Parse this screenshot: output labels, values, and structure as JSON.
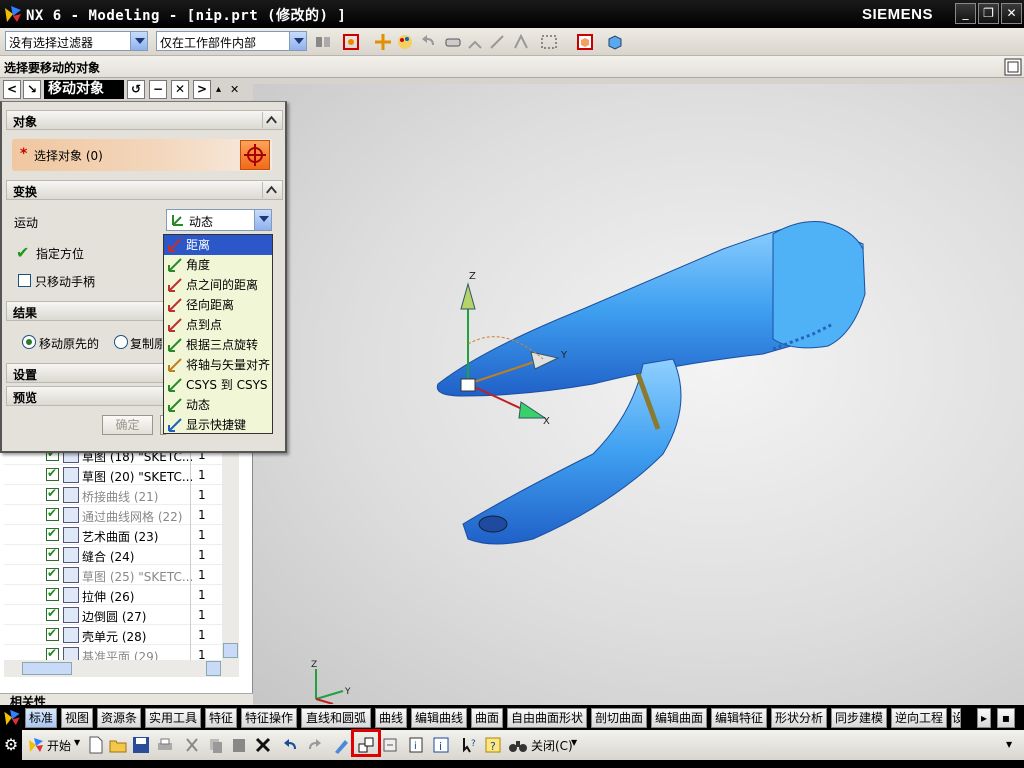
{
  "window": {
    "title": "NX 6 - Modeling - [nip.prt  (修改的) ]",
    "brand": "SIEMENS",
    "controls": [
      "_",
      "❐",
      "✕"
    ]
  },
  "toolbar": {
    "selection_filter": "没有选择过滤器",
    "selection_scope": "仅在工作部件内部"
  },
  "cue_line": "选择要移动的对象",
  "dialog": {
    "title": "移动对象",
    "object_group": "对象",
    "select_object": "选择对象 (0)",
    "transform_group": "变换",
    "motion_label": "运动",
    "motion_value": "动态",
    "specify_orientation": "指定方位",
    "move_handle_only": "只移动手柄",
    "result_group": "结果",
    "move_original": "移动原先的",
    "copy_original": "复制原先的",
    "settings_group": "设置",
    "preview_group": "预览",
    "ok_button": "确定",
    "motion_options": [
      {
        "label": "距离",
        "icon": "distance-icon",
        "selected": true
      },
      {
        "label": "角度",
        "icon": "angle-icon",
        "selected": false
      },
      {
        "label": "点之间的距离",
        "icon": "point-distance-icon",
        "selected": false
      },
      {
        "label": "径向距离",
        "icon": "radial-distance-icon",
        "selected": false
      },
      {
        "label": "点到点",
        "icon": "point-to-point-icon",
        "selected": false
      },
      {
        "label": "根据三点旋转",
        "icon": "three-point-rotate-icon",
        "selected": false
      },
      {
        "label": "将轴与矢量对齐",
        "icon": "align-axis-vector-icon",
        "selected": false
      },
      {
        "label": "CSYS 到 CSYS",
        "icon": "csys-to-csys-icon",
        "selected": false
      },
      {
        "label": "动态",
        "icon": "dynamic-icon",
        "selected": false
      },
      {
        "label": "显示快捷键",
        "icon": "show-shortcuts-icon",
        "selected": false
      }
    ]
  },
  "part_navigator": {
    "rows": [
      {
        "name": "草图 (18) \"SKETC...",
        "value": "1",
        "icon": "sketch-icon",
        "grey": false
      },
      {
        "name": "草图 (20) \"SKETC...",
        "value": "1",
        "icon": "sketch-icon",
        "grey": false
      },
      {
        "name": "桥接曲线 (21)",
        "value": "1",
        "icon": "bridge-curve-icon",
        "grey": true
      },
      {
        "name": "通过曲线网格 (22)",
        "value": "1",
        "icon": "curve-mesh-icon",
        "grey": true
      },
      {
        "name": "艺术曲面 (23)",
        "value": "1",
        "icon": "studio-surface-icon",
        "grey": false
      },
      {
        "name": "缝合 (24)",
        "value": "1",
        "icon": "sew-icon",
        "grey": false
      },
      {
        "name": "草图 (25) \"SKETC...",
        "value": "1",
        "icon": "sketch-icon",
        "grey": true
      },
      {
        "name": "拉伸 (26)",
        "value": "1",
        "icon": "extrude-icon",
        "grey": false
      },
      {
        "name": "边倒圆 (27)",
        "value": "1",
        "icon": "edge-blend-icon",
        "grey": false
      },
      {
        "name": "壳单元 (28)",
        "value": "1",
        "icon": "shell-icon",
        "grey": false
      },
      {
        "name": "基准平面 (29)",
        "value": "1",
        "icon": "datum-plane-icon",
        "grey": true
      }
    ],
    "related_label": "相关性"
  },
  "ribbon_tabs": [
    "标准",
    "视图",
    "资源条",
    "实用工具",
    "特征",
    "特征操作",
    "直线和圆弧",
    "曲线",
    "编辑曲线",
    "曲面",
    "自由曲面形状",
    "剖切曲面",
    "编辑曲面",
    "编辑特征",
    "形状分析",
    "同步建模",
    "逆向工程",
    "设"
  ],
  "bottom_toolbar": {
    "start_label": "开始",
    "close_label": "关闭(C)"
  },
  "viewport": {
    "axis_x": "X",
    "axis_y": "Y",
    "axis_z": "Z"
  },
  "colors": {
    "model": "#4aa7f2",
    "selection_highlight": "#2c57c8",
    "dropdown_bg": "#f1f7d6",
    "highlight_box": "#e00000"
  }
}
